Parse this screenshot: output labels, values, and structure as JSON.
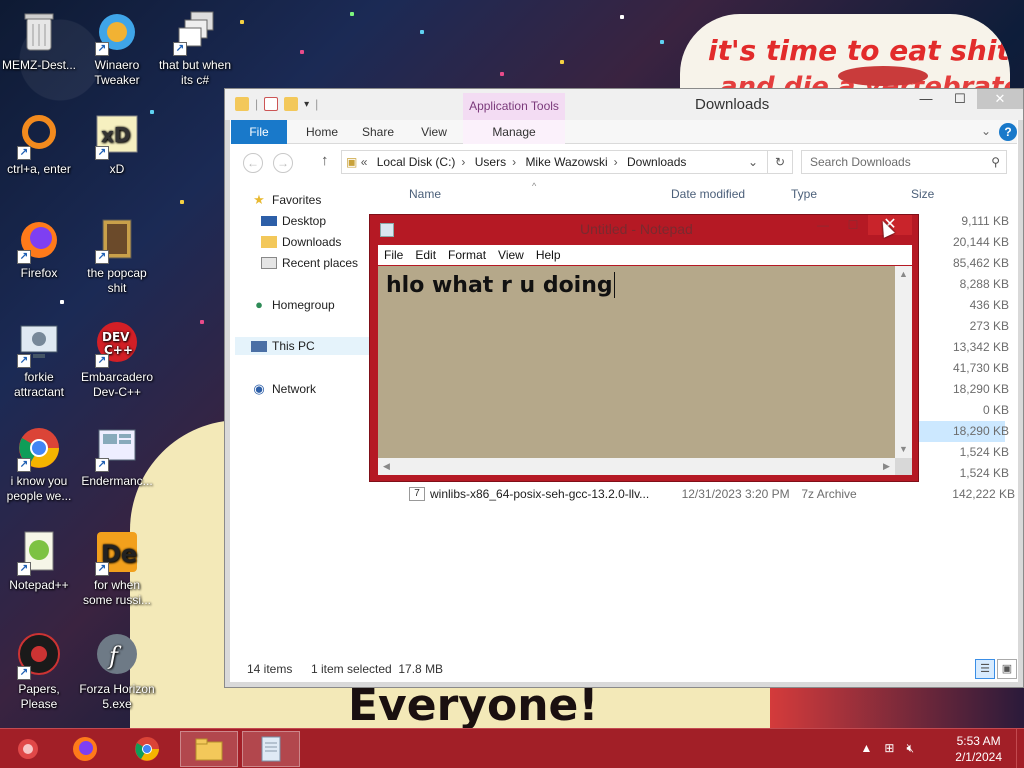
{
  "wallpaper": {
    "top_right_text_line1": "it's time to eat shit",
    "top_right_text_line2": "and die a vertebrate",
    "bottom_banner_text": "Everyone!"
  },
  "desktop_icons": [
    {
      "label": "MEMZ-Dest...",
      "icon": "recycle-bin-icon"
    },
    {
      "label": "Winaero Tweaker",
      "icon": "winaero-icon"
    },
    {
      "label": "that but when its c#",
      "icon": "windows-stack-icon"
    },
    {
      "label": "ctrl+a, enter",
      "icon": "orange-ring-icon"
    },
    {
      "label": "xD",
      "icon": "hxd-icon"
    },
    {
      "label": "Firefox",
      "icon": "firefox-icon"
    },
    {
      "label": "the popcap shit",
      "icon": "popcap-icon"
    },
    {
      "label": "forkie attractant",
      "icon": "gear-monitor-icon"
    },
    {
      "label": "Embarcadero Dev-C++",
      "icon": "devcpp-icon"
    },
    {
      "label": "i know you people we...",
      "icon": "chrome-icon"
    },
    {
      "label": "Endermanc...",
      "icon": "endermanch-icon"
    },
    {
      "label": "Notepad++",
      "icon": "notepadpp-icon"
    },
    {
      "label": "for when some russi...",
      "icon": "de-icon"
    },
    {
      "label": "Papers, Please",
      "icon": "papers-please-icon"
    },
    {
      "label": "Forza Horizon 5.exe",
      "icon": "flash-icon"
    }
  ],
  "explorer": {
    "title": "Downloads",
    "context_tab_group": "Application Tools",
    "ribbon_tabs": [
      "File",
      "Home",
      "Share",
      "View",
      "Manage"
    ],
    "address": [
      "Local Disk (C:)",
      "Users",
      "Mike Wazowski",
      "Downloads"
    ],
    "address_prefix": "«",
    "search_placeholder": "Search Downloads",
    "nav": {
      "favorites": "Favorites",
      "desktop": "Desktop",
      "downloads": "Downloads",
      "recent": "Recent places",
      "homegroup": "Homegroup",
      "this_pc": "This PC",
      "network": "Network"
    },
    "columns": {
      "name": "Name",
      "date": "Date modified",
      "type": "Type",
      "size": "Size"
    },
    "sizes": [
      "9,111 KB",
      "20,144 KB",
      "85,462 KB",
      "8,288 KB",
      "436 KB",
      "273 KB",
      "13,342 KB",
      "41,730 KB",
      "18,290 KB",
      "0 KB",
      "18,290 KB",
      "1,524 KB",
      "1,524 KB"
    ],
    "selected_index": 10,
    "last_row": {
      "name": "winlibs-x86_64-posix-seh-gcc-13.2.0-llv...",
      "date": "12/31/2023 3:20 PM",
      "type": "7z Archive",
      "size": "142,222 KB"
    },
    "status": {
      "count": "14 items",
      "selection": "1 item selected  17.8 MB"
    }
  },
  "notepad": {
    "title": "Untitled - Notepad",
    "menu": [
      "File",
      "Edit",
      "Format",
      "View",
      "Help"
    ],
    "text": "hlo what r u doing"
  },
  "taskbar": {
    "time": "5:53 AM",
    "date": "2/1/2024"
  }
}
